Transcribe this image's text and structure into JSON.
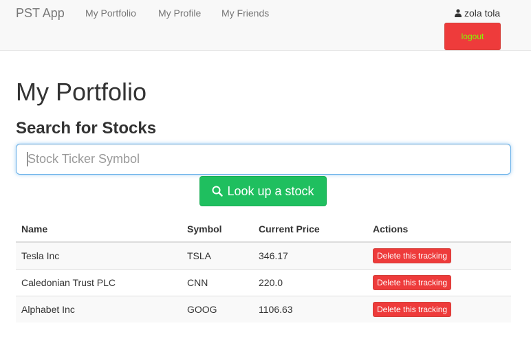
{
  "navbar": {
    "brand": "PST App",
    "links": [
      "My Portfolio",
      "My Profile",
      "My Friends"
    ],
    "user_name": "zola tola",
    "user_icon": "user-icon",
    "logout_label": "logout"
  },
  "main": {
    "title": "My Portfolio",
    "search_title": "Search for Stocks",
    "search_placeholder": "Stock Ticker Symbol",
    "lookup_label": "Look up a stock",
    "lookup_icon": "search-icon"
  },
  "table": {
    "headers": [
      "Name",
      "Symbol",
      "Current Price",
      "Actions"
    ],
    "rows": [
      {
        "name": "Tesla Inc",
        "symbol": "TSLA",
        "price": "346.17",
        "action": "Delete this tracking"
      },
      {
        "name": "Caledonian Trust PLC",
        "symbol": "CNN",
        "price": "220.0",
        "action": "Delete this tracking"
      },
      {
        "name": "Alphabet Inc",
        "symbol": "GOOG",
        "price": "1106.63",
        "action": "Delete this tracking"
      }
    ]
  },
  "colors": {
    "navbar_bg": "#f8f8f8",
    "danger": "#ee3b3b",
    "logout_text": "#7fff00",
    "success": "#1fbf5f",
    "focus_border": "#66afe9"
  }
}
